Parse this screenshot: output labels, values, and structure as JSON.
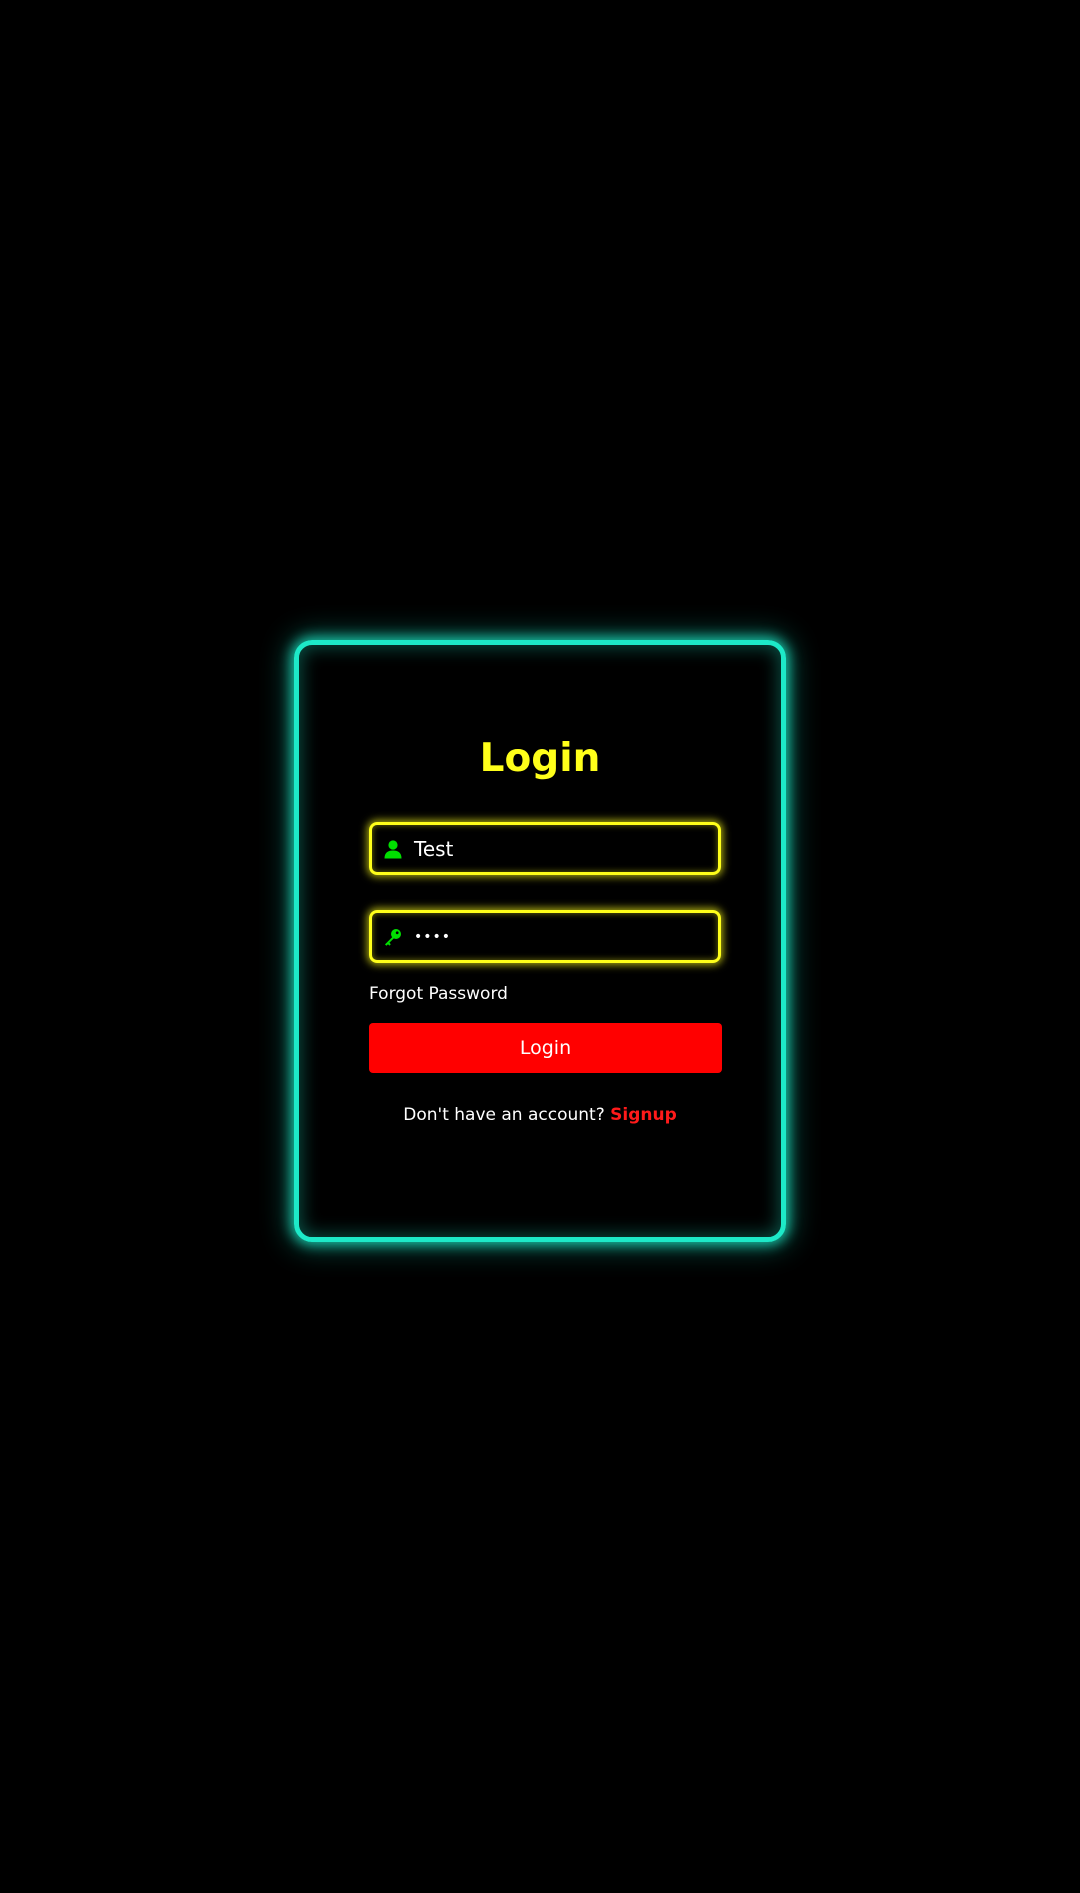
{
  "login_card": {
    "title": "Login",
    "username": {
      "value": "Test",
      "icon": "user-icon"
    },
    "password": {
      "value": "••••",
      "icon": "key-icon"
    },
    "forgot_password_label": "Forgot Password",
    "login_button_label": "Login",
    "signup_prompt": "Don't have an account?",
    "signup_link_label": "Signup"
  },
  "colors": {
    "background": "#000000",
    "card_border": "#1de9c8",
    "field_border": "#ffff1a",
    "title": "#ffff1a",
    "icon": "#00e000",
    "button": "#ff0000",
    "signup_link": "#ff1a1a",
    "text": "#ffffff"
  }
}
